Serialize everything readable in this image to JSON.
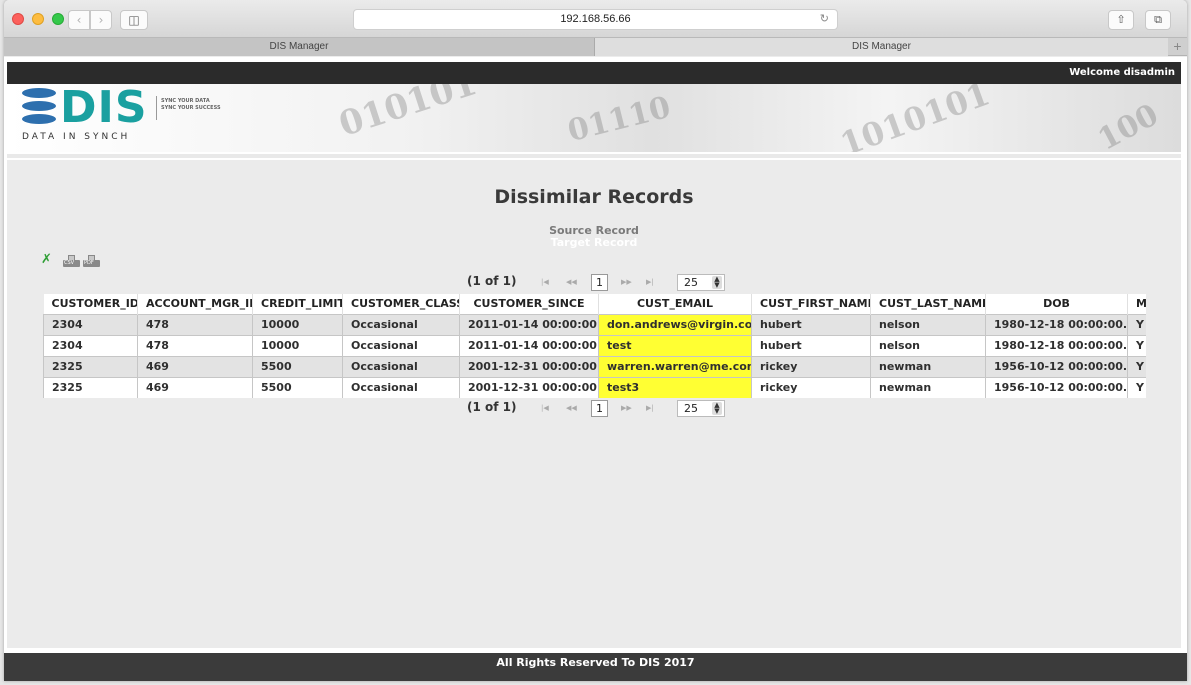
{
  "browser": {
    "url": "192.168.56.66",
    "tabs": [
      {
        "label": "DIS Manager"
      },
      {
        "label": "DIS Manager"
      }
    ]
  },
  "header": {
    "welcome": "Welcome disadmin",
    "logo_text": "DIS",
    "logo_sub": "DATA IN SYNCH",
    "tagline1": "SYNC YOUR DATA",
    "tagline2": "SYNC YOUR SUCCESS"
  },
  "main": {
    "title": "Dissimilar Records",
    "legend_source": "Source Record",
    "legend_target": "Target Record",
    "exports": {
      "csv": "CSV",
      "pdf": "PDF"
    },
    "pager": {
      "count": "(1 of 1)",
      "current_page": "1",
      "page_size": "25"
    },
    "columns": [
      "CUSTOMER_ID",
      "ACCOUNT_MGR_ID",
      "CREDIT_LIMIT",
      "CUSTOMER_CLASS",
      "CUSTOMER_SINCE",
      "CUST_EMAIL",
      "CUST_FIRST_NAME",
      "CUST_LAST_NAME",
      "DOB",
      "MA"
    ],
    "rows": [
      {
        "type": "source",
        "cells": [
          "2304",
          "478",
          "10000",
          "Occasional",
          "2011-01-14 00:00:00.0",
          "don.andrews@virgin.com",
          "hubert",
          "nelson",
          "1980-12-18 00:00:00.0",
          "Y"
        ]
      },
      {
        "type": "target",
        "cells": [
          "2304",
          "478",
          "10000",
          "Occasional",
          "2011-01-14 00:00:00.0",
          "test",
          "hubert",
          "nelson",
          "1980-12-18 00:00:00.0",
          "Y"
        ]
      },
      {
        "type": "source",
        "cells": [
          "2325",
          "469",
          "5500",
          "Occasional",
          "2001-12-31 00:00:00.0",
          "warren.warren@me.com",
          "rickey",
          "newman",
          "1956-10-12 00:00:00.0",
          "Y"
        ]
      },
      {
        "type": "target",
        "cells": [
          "2325",
          "469",
          "5500",
          "Occasional",
          "2001-12-31 00:00:00.0",
          "test3",
          "rickey",
          "newman",
          "1956-10-12 00:00:00.0",
          "Y"
        ]
      }
    ],
    "highlight_color": "#ffff33"
  },
  "footer": {
    "text": "All Rights Reserved To DIS 2017"
  }
}
